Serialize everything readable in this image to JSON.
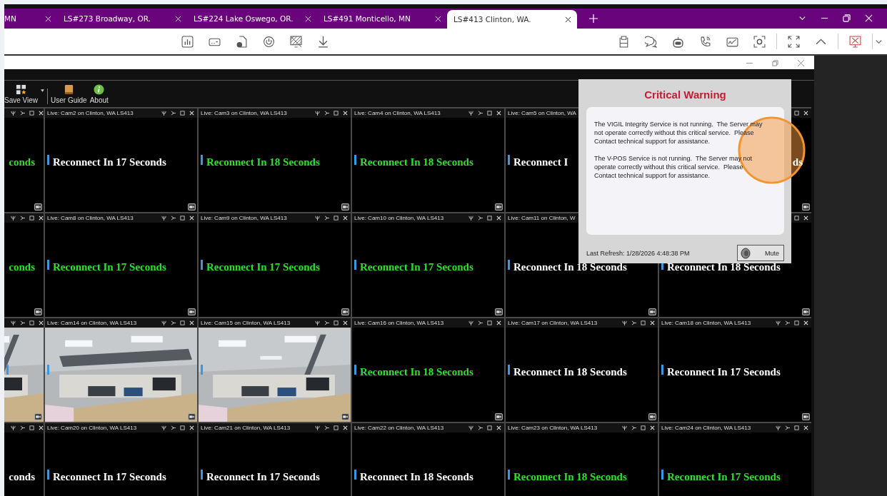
{
  "browser_tabs": [
    {
      "label": "MN",
      "selected": false
    },
    {
      "label": "LS#273 Broadway, OR.",
      "selected": false
    },
    {
      "label": "LS#224 Lake Oswego, OR.",
      "selected": false
    },
    {
      "label": "LS#491 Monticello, MN",
      "selected": false
    },
    {
      "label": "LS#413 Clinton, WA.",
      "selected": true
    }
  ],
  "app_toolbar": [
    {
      "kind": "save_view",
      "label": "Save View"
    },
    {
      "kind": "user_guide",
      "label": "User Guide"
    },
    {
      "kind": "about",
      "label": "About"
    }
  ],
  "camera_grid": [
    [
      {
        "kind": "message_cut",
        "message": "conds",
        "color": "#2ee02e"
      },
      {
        "kind": "message",
        "title": "Live: Cam2 on Clinton, WA LS413",
        "message": "Reconnect In 17 Seconds",
        "color": "#ffffff"
      },
      {
        "kind": "message",
        "title": "Live: Cam3 on Clinton, WA LS413",
        "message": "Reconnect In 18 Seconds",
        "color": "#2ee02e"
      },
      {
        "kind": "message",
        "title": "Live: Cam4 on Clinton, WA LS413",
        "message": "Reconnect In 18 Seconds",
        "color": "#2ee02e"
      },
      {
        "kind": "message_corner_covered",
        "title": "Live: Cam5 on Clinton, WA",
        "message": "Reconnect I",
        "color": "#ffffff"
      },
      {
        "kind": "message_cut_half_covered",
        "message": "ds",
        "color": "#ffffff"
      }
    ],
    [
      {
        "kind": "message_cut",
        "message": "conds",
        "color": "#2ee02e"
      },
      {
        "kind": "message",
        "title": "Live: Cam8 on Clinton, WA LS413",
        "message": "Reconnect In 17 Seconds",
        "color": "#2ee02e"
      },
      {
        "kind": "message",
        "title": "Live: Cam9 on Clinton, WA LS413",
        "message": "Reconnect In 17 Seconds",
        "color": "#2ee02e"
      },
      {
        "kind": "message",
        "title": "Live: Cam10 on Clinton, WA LS413",
        "message": "Reconnect In 17 Seconds",
        "color": "#2ee02e"
      },
      {
        "kind": "message_covered",
        "title": "Live: Cam11 on Clinton, W",
        "message": "Reconnect In 18 Seconds",
        "color": "#ffffff"
      },
      {
        "kind": "message_half_covered",
        "message": "Reconnect In 18 Seconds",
        "color": "#ffffff"
      }
    ],
    [
      {
        "kind": "picture"
      },
      {
        "kind": "picture",
        "title": "Live: Cam14 on Clinton, WA LS413"
      },
      {
        "kind": "picture",
        "title": "Live: Cam15 on Clinton, WA LS413"
      },
      {
        "kind": "message",
        "title": "Live: Cam16 on Clinton, WA LS413",
        "message": "Reconnect In 18 Seconds",
        "color": "#2ee02e"
      },
      {
        "kind": "message",
        "title": "Live: Cam17 on Clinton, WA LS413",
        "message": "Reconnect In 18 Seconds",
        "color": "#ffffff"
      },
      {
        "kind": "message",
        "title": "Live: Cam18 on Clinton, WA LS413",
        "message": "Reconnect In 17 Seconds",
        "color": "#ffffff"
      }
    ],
    [
      {
        "kind": "message_cut",
        "message": "conds",
        "color": "#ffffff"
      },
      {
        "kind": "message",
        "title": "Live: Cam20 on Clinton, WA LS413",
        "message": "Reconnect In 17 Seconds",
        "color": "#ffffff"
      },
      {
        "kind": "message",
        "title": "Live: Cam21 on Clinton, WA LS413",
        "message": "Reconnect In 17 Seconds",
        "color": "#ffffff"
      },
      {
        "kind": "message",
        "title": "Live: Cam22 on Clinton, WA LS413",
        "message": "Reconnect In 18 Seconds",
        "color": "#ffffff"
      },
      {
        "kind": "message",
        "title": "Live: Cam23 on Clinton, WA LS413",
        "message": "Reconnect In 18 Seconds",
        "color": "#2ee02e"
      },
      {
        "kind": "message",
        "title": "Live: Cam24 on Clinton, WA LS413",
        "message": "Reconnect In 17 Seconds",
        "color": "#2ee02e"
      }
    ]
  ],
  "warning_dialog": {
    "title": "Critical Warning",
    "messages": [
      "The VIGIL Integrity Service is not running.  The Server may not operate correctly without this critical service.  Please Contact technical support for assistance.",
      "The V-POS Service is not running.  The Server may not operate correctly without this critical service.  Please Contact technical support for assistance."
    ],
    "last_refresh": "Last Refresh:  1/28/2026 4:48:38 PM",
    "mute_label": "Mute"
  }
}
